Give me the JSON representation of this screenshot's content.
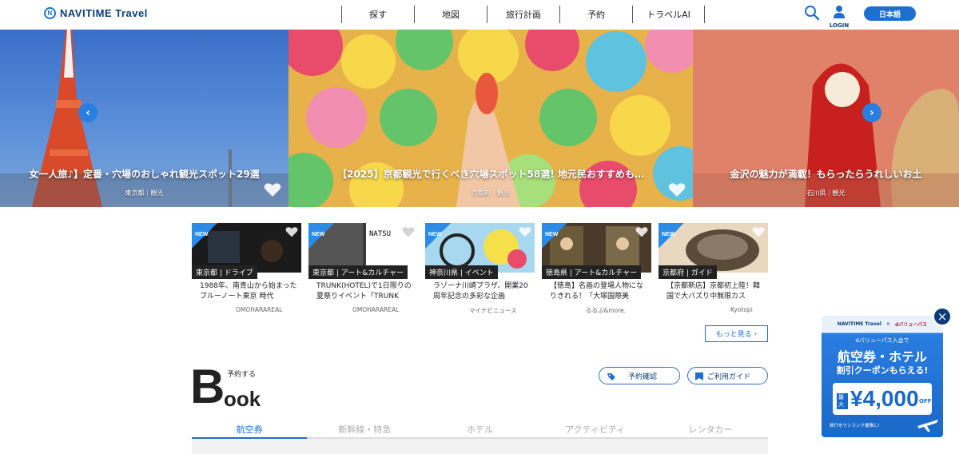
{
  "header": {
    "logo_mark": "N",
    "logo_text": "NAVITIME Travel",
    "nav": [
      "探す",
      "地図",
      "旅行計画",
      "予約",
      "トラベルAI"
    ],
    "login_label": "LOGIN",
    "lang_label": "日本語"
  },
  "hero": {
    "slides": [
      {
        "title": "女一人旅♪】定番・穴場のおしゃれ観光スポット29選",
        "location": "東京都｜観光"
      },
      {
        "title": "【2025】京都観光で行くべき穴場スポット58選! 地元民おすすめも…",
        "location": "京都府｜観光"
      },
      {
        "title": "金沢の魅力が満載！もらったらうれしいお土",
        "location": "石川県｜観光"
      }
    ],
    "prev_glyph": "‹",
    "next_glyph": "›"
  },
  "cards": [
    {
      "badge": "NEW",
      "category": "東京都 | ドライブ",
      "desc": "1988年、南青山から始まったブルーノート東京 時代",
      "source": "OMOHARAREAL"
    },
    {
      "badge": "NEW",
      "category": "東京都 | アート&カルチャー",
      "desc": "TRUNK(HOTEL)で1日限りの夏祭りイベント「TRUNK",
      "source": "OMOHARAREAL"
    },
    {
      "badge": "NEW",
      "category": "神奈川県 | イベント",
      "desc": "ラゾーナ川崎プラザ、開業20周年記念の多彩な企画",
      "source": "マイナビニュース"
    },
    {
      "badge": "NEW",
      "category": "徳島県 | アート&カルチャー",
      "desc": "【徳島】名画の登場人物になりきれる！「大塚国際美",
      "source": "るるぶ&more."
    },
    {
      "badge": "NEW",
      "category": "京都府 | ガイド",
      "desc": "【京都新店】京都初上陸！韓国で大バズり中無限カス",
      "source": "Kyotopi"
    }
  ],
  "more_label": "もっと見る",
  "book": {
    "big_letter": "B",
    "rest": "ook",
    "subtitle": "予約する",
    "confirm_label": "予約確認",
    "guide_label": "ご利用ガイド",
    "tabs": [
      "航空券",
      "新幹線・特急",
      "ホテル",
      "アクティビティ",
      "レンタカー"
    ],
    "active_tab": 0
  },
  "ad": {
    "brand1": "NAVITIME Travel",
    "sep": "×",
    "brand2": "dバリューパス",
    "line1": "dバリューパス入会で",
    "line2": "航空券・ホテル",
    "line3": "割引クーポンもらえる!",
    "max_label": "最大",
    "amount": "¥4,000",
    "off": "OFF",
    "note": "旅行をワンランク優雅に!"
  },
  "close_glyph": "×",
  "colors": {
    "accent": "#1e6fd0",
    "navy": "#0a3d78",
    "new_badge": "#2c8be6"
  }
}
